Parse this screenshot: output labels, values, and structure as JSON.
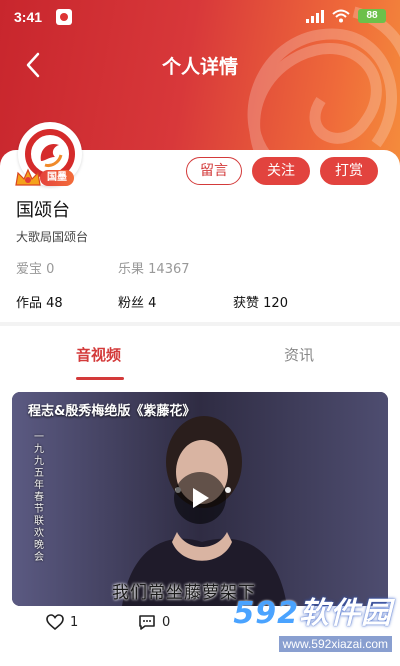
{
  "status_bar": {
    "time": "3:41",
    "battery": "88"
  },
  "header": {
    "title": "个人详情"
  },
  "profile": {
    "badge": "国墨",
    "name": "国颂台",
    "description": "大歌局国颂台",
    "aibao_label": "爱宝",
    "aibao_value": "0",
    "leguo_label": "乐果",
    "leguo_value": "14367",
    "works_label": "作品",
    "works_value": "48",
    "fans_label": "粉丝",
    "fans_value": "4",
    "likes_label": "获赞",
    "likes_value": "120"
  },
  "buttons": {
    "message": "留言",
    "follow": "关注",
    "tip": "打赏"
  },
  "tabs": [
    {
      "label": "音视频",
      "active": true
    },
    {
      "label": "资讯",
      "active": false
    }
  ],
  "video": {
    "title": "程志&殷秀梅绝版《紫藤花》",
    "vertical_text": "一九九五年春节联欢晚会",
    "subtitle": "我们常坐藤萝架下",
    "like_count": "1",
    "comment_count": "0"
  },
  "watermark": {
    "brand_number": "592",
    "brand_text": "软件园",
    "url": "www.592xiazai.com"
  },
  "colors": {
    "accent": "#d33a3a",
    "header_start": "#c8262d",
    "header_end": "#f5903c"
  }
}
